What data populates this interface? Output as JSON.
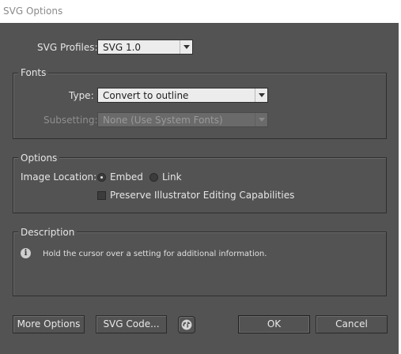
{
  "window": {
    "title": "SVG Options"
  },
  "profiles": {
    "label": "SVG Profiles:",
    "value": "SVG 1.0"
  },
  "fonts": {
    "group_title": "Fonts",
    "type_label": "Type:",
    "type_value": "Convert to outline",
    "subsetting_label": "Subsetting:",
    "subsetting_value": "None (Use System Fonts)"
  },
  "options": {
    "group_title": "Options",
    "image_location_label": "Image Location:",
    "embed_label": "Embed",
    "link_label": "Link",
    "image_location_selected": "Embed",
    "preserve_label": "Preserve Illustrator Editing Capabilities",
    "preserve_checked": false
  },
  "description": {
    "group_title": "Description",
    "text": "Hold the cursor over a setting for additional information.",
    "icon": "info-icon"
  },
  "buttons": {
    "more_options": "More Options",
    "svg_code": "SVG Code...",
    "globe_icon": "globe-icon",
    "ok": "OK",
    "cancel": "Cancel"
  }
}
